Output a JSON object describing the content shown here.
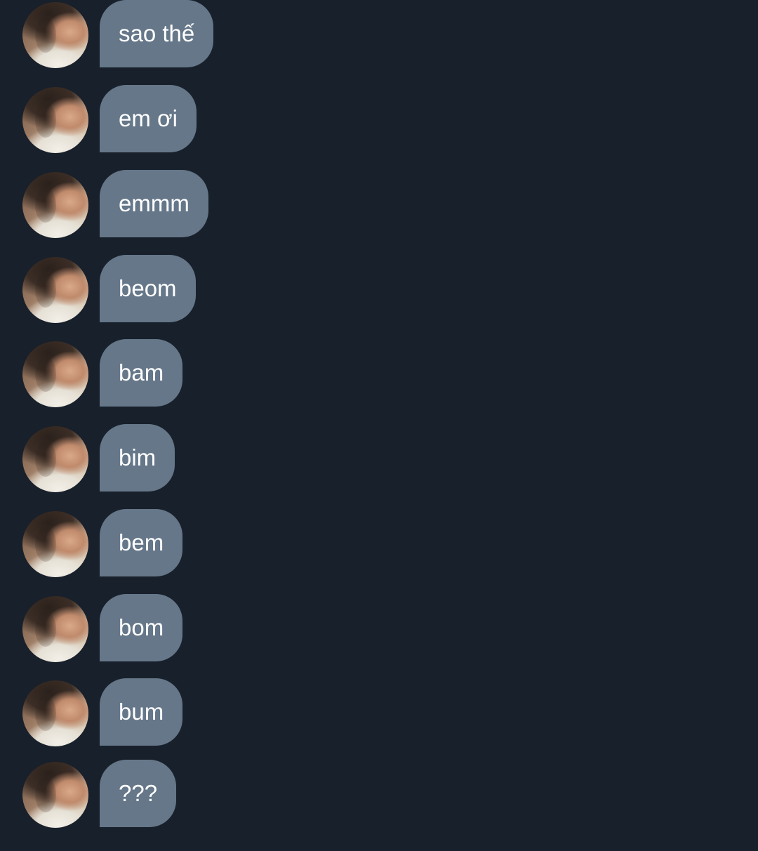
{
  "chat": {
    "messages": [
      {
        "text": "sao thế"
      },
      {
        "text": "em ơi"
      },
      {
        "text": "emmm"
      },
      {
        "text": "beom"
      },
      {
        "text": "bam"
      },
      {
        "text": "bim"
      },
      {
        "text": "bem"
      },
      {
        "text": "bom"
      },
      {
        "text": "bum"
      },
      {
        "text": "???"
      }
    ]
  },
  "colors": {
    "background": "#18202b",
    "bubble": "#657789",
    "bubble_text": "#ffffff"
  },
  "icons": {
    "avatar": "avatar-photo"
  }
}
